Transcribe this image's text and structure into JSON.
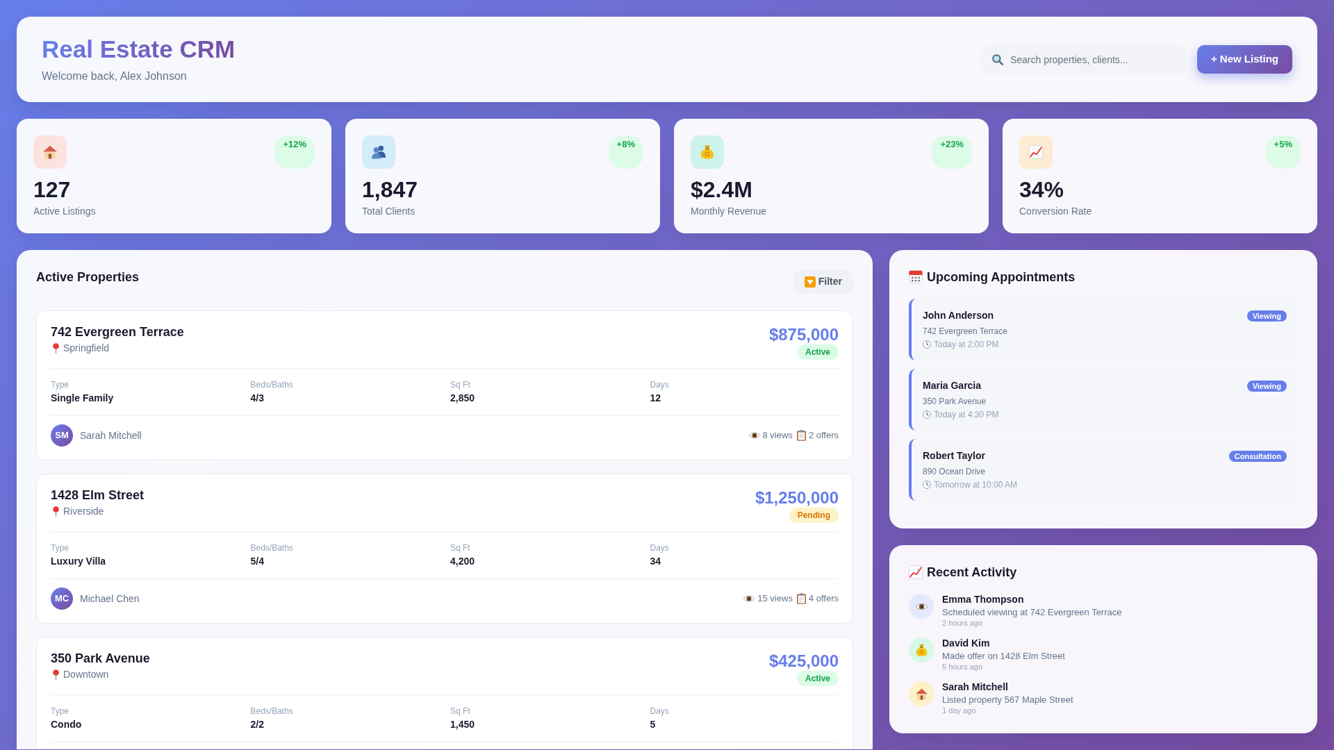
{
  "header": {
    "title": "Real Estate CRM",
    "subtitle": "Welcome back, Alex Johnson",
    "search": {
      "placeholder": "Search properties, clients..."
    },
    "new_listing_button": "+ New Listing"
  },
  "stats": [
    {
      "kind": "listings",
      "value": "127",
      "label": "Active Listings",
      "change": "+12%"
    },
    {
      "kind": "clients",
      "value": "1,847",
      "label": "Total Clients",
      "change": "+8%"
    },
    {
      "kind": "revenue",
      "value": "$2.4M",
      "label": "Monthly Revenue",
      "change": "+23%"
    },
    {
      "kind": "conversion",
      "value": "34%",
      "label": "Conversion Rate",
      "change": "+5%"
    }
  ],
  "properties_panel": {
    "title": "Active Properties",
    "filter_button": "Filter",
    "properties": [
      {
        "name": "742 Evergreen Terrace",
        "location": "Springfield",
        "price": "$875,000",
        "status": {
          "label": "Active",
          "kind": "active"
        },
        "details": [
          {
            "label": "Type",
            "value": "Single Family"
          },
          {
            "label": "Beds/Baths",
            "value": "4/3"
          },
          {
            "label": "Sq Ft",
            "value": "2,850"
          },
          {
            "label": "Days",
            "value": "12"
          }
        ],
        "agent": {
          "initials": "SM",
          "name": "Sarah Mitchell"
        },
        "views": "8 views",
        "offers": "2 offers"
      },
      {
        "name": "1428 Elm Street",
        "location": "Riverside",
        "price": "$1,250,000",
        "status": {
          "label": "Pending",
          "kind": "pending"
        },
        "details": [
          {
            "label": "Type",
            "value": "Luxury Villa"
          },
          {
            "label": "Beds/Baths",
            "value": "5/4"
          },
          {
            "label": "Sq Ft",
            "value": "4,200"
          },
          {
            "label": "Days",
            "value": "34"
          }
        ],
        "agent": {
          "initials": "MC",
          "name": "Michael Chen"
        },
        "views": "15 views",
        "offers": "4 offers"
      },
      {
        "name": "350 Park Avenue",
        "location": "Downtown",
        "price": "$425,000",
        "status": {
          "label": "Active",
          "kind": "active"
        },
        "details": [
          {
            "label": "Type",
            "value": "Condo"
          },
          {
            "label": "Beds/Baths",
            "value": "2/2"
          },
          {
            "label": "Sq Ft",
            "value": "1,450"
          },
          {
            "label": "Days",
            "value": "5"
          }
        ]
      }
    ]
  },
  "appointments_panel": {
    "title": "Upcoming Appointments",
    "appointments": [
      {
        "name": "John Anderson",
        "type": "Viewing",
        "address": "742 Evergreen Terrace",
        "time": "Today at 2:00 PM"
      },
      {
        "name": "Maria Garcia",
        "type": "Viewing",
        "address": "350 Park Avenue",
        "time": "Today at 4:30 PM"
      },
      {
        "name": "Robert Taylor",
        "type": "Consultation",
        "address": "890 Ocean Drive",
        "time": "Tomorrow at 10:00 AM"
      }
    ]
  },
  "activity_panel": {
    "title": "Recent Activity",
    "activities": [
      {
        "kind": "viewing",
        "name": "Emma Thompson",
        "description": "Scheduled viewing at 742 Evergreen Terrace",
        "time": "2 hours ago"
      },
      {
        "kind": "offer",
        "name": "David Kim",
        "description": "Made offer on 1428 Elm Street",
        "time": "5 hours ago"
      },
      {
        "kind": "listing",
        "name": "Sarah Mitchell",
        "description": "Listed property 567 Maple Street",
        "time": "1 day ago"
      }
    ]
  }
}
